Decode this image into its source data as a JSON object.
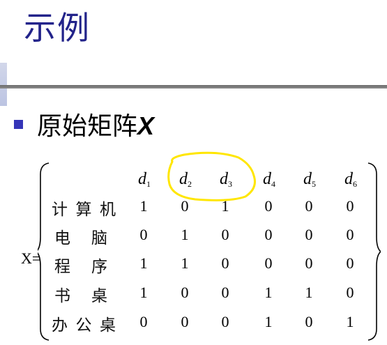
{
  "slide": {
    "title": "示例",
    "bullet": {
      "text": "原始矩阵",
      "variable": "X"
    }
  },
  "matrix": {
    "label": "X=",
    "columns": [
      {
        "letter": "d",
        "index": "1"
      },
      {
        "letter": "d",
        "index": "2"
      },
      {
        "letter": "d",
        "index": "3"
      },
      {
        "letter": "d",
        "index": "4"
      },
      {
        "letter": "d",
        "index": "5"
      },
      {
        "letter": "d",
        "index": "6"
      }
    ],
    "rows": [
      {
        "label": [
          "计",
          "算",
          "机"
        ],
        "values": [
          "1",
          "0",
          "1",
          "0",
          "0",
          "0"
        ]
      },
      {
        "label": [
          "电",
          "脑"
        ],
        "values": [
          "0",
          "1",
          "0",
          "0",
          "0",
          "0"
        ]
      },
      {
        "label": [
          "程",
          "序"
        ],
        "values": [
          "1",
          "1",
          "0",
          "0",
          "0",
          "0"
        ]
      },
      {
        "label": [
          "书",
          "桌"
        ],
        "values": [
          "1",
          "0",
          "0",
          "1",
          "1",
          "0"
        ]
      },
      {
        "label": [
          "办",
          "公",
          "桌"
        ],
        "values": [
          "0",
          "0",
          "0",
          "1",
          "0",
          "1"
        ]
      }
    ]
  },
  "colors": {
    "title": "#22238a",
    "bullet": "#3535b8",
    "highlight": "#ffe600"
  }
}
